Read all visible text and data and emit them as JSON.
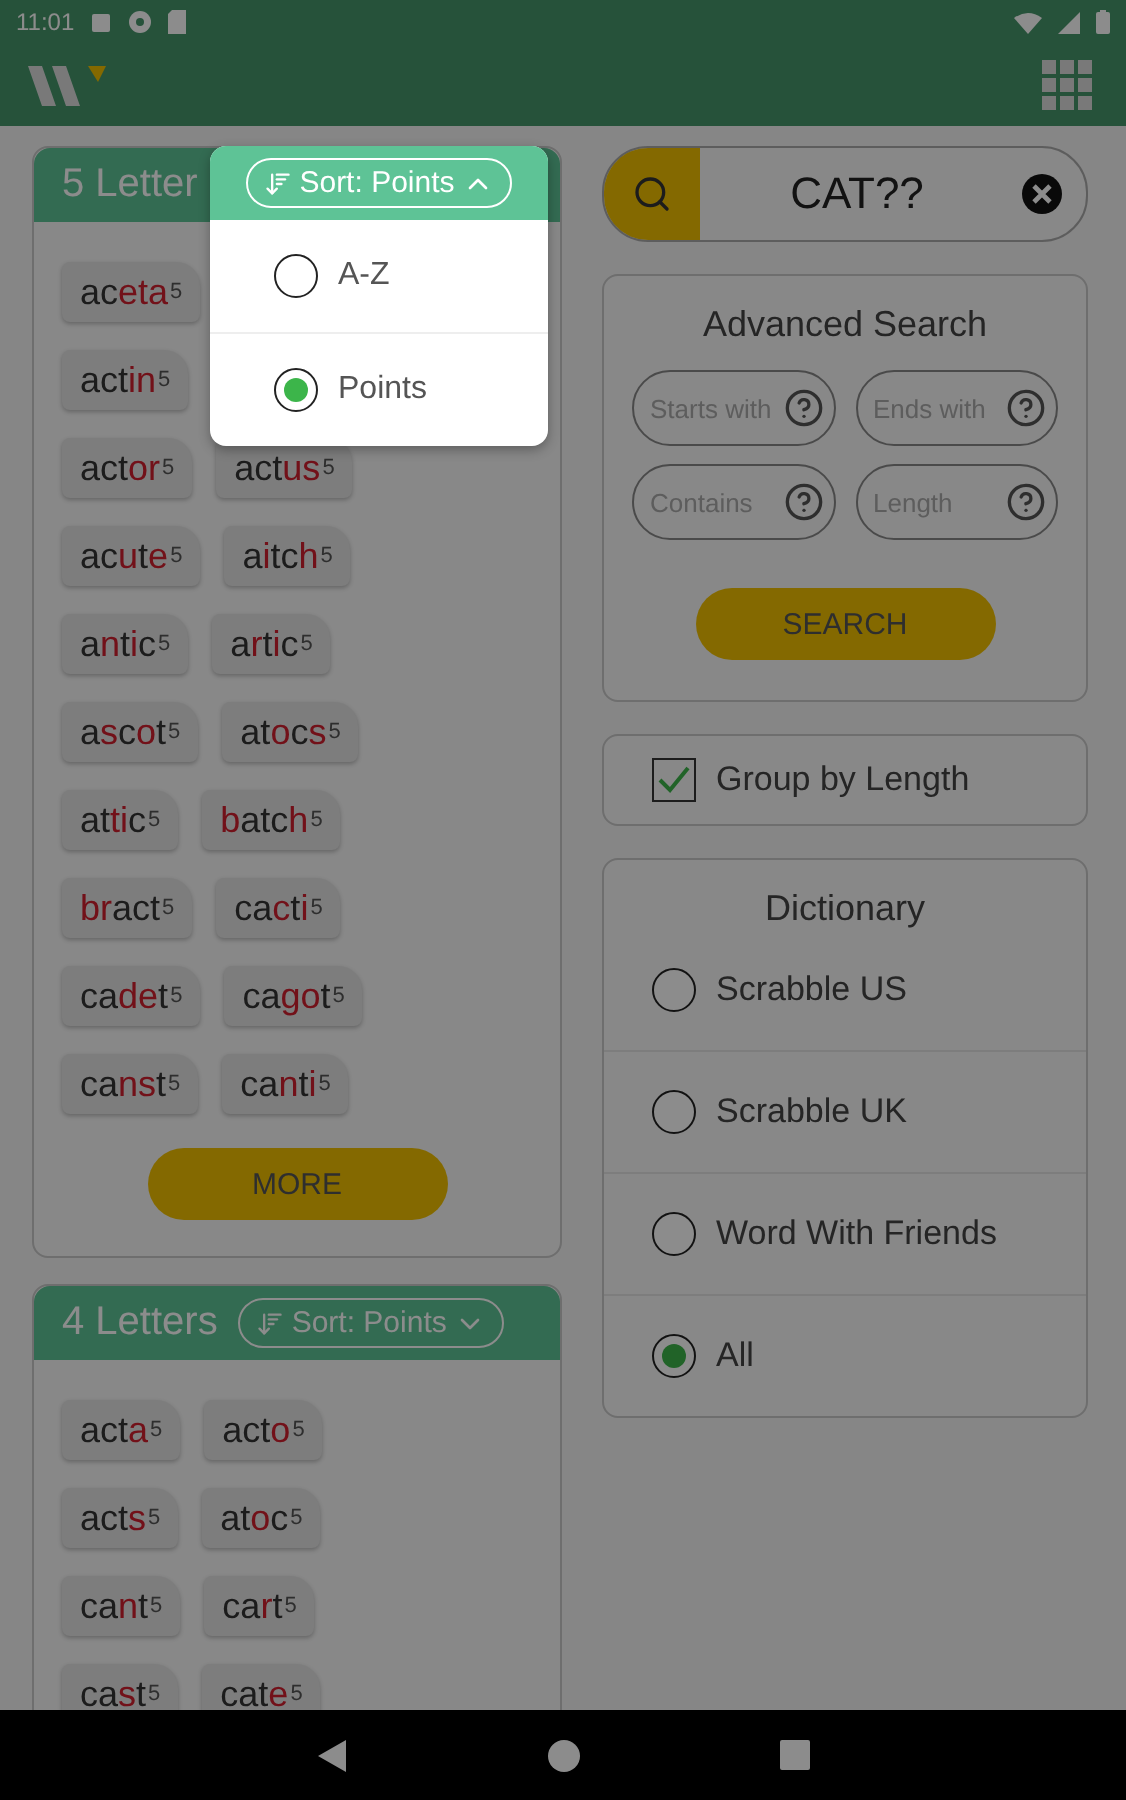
{
  "status_bar": {
    "time": "11:01"
  },
  "sections": [
    {
      "title": "5 Letter",
      "rows": [
        [
          {
            "parts": [
              {
                "text": "ac",
                "wild": false
              },
              {
                "text": "eta",
                "wild": true
              }
            ],
            "points": "5"
          }
        ],
        [
          {
            "parts": [
              {
                "text": "act",
                "wild": false
              },
              {
                "text": "in",
                "wild": true
              }
            ],
            "points": "5"
          }
        ],
        [
          {
            "parts": [
              {
                "text": "act",
                "wild": false
              },
              {
                "text": "or",
                "wild": true
              }
            ],
            "points": "5"
          },
          {
            "parts": [
              {
                "text": "act",
                "wild": false
              },
              {
                "text": "us",
                "wild": true
              }
            ],
            "points": "5"
          }
        ],
        [
          {
            "parts": [
              {
                "text": "ac",
                "wild": false
              },
              {
                "text": "u",
                "wild": true
              },
              {
                "text": "t",
                "wild": false
              },
              {
                "text": "e",
                "wild": true
              }
            ],
            "points": "5"
          },
          {
            "parts": [
              {
                "text": "a",
                "wild": false
              },
              {
                "text": "i",
                "wild": true
              },
              {
                "text": "tc",
                "wild": false
              },
              {
                "text": "h",
                "wild": true
              }
            ],
            "points": "5"
          }
        ],
        [
          {
            "parts": [
              {
                "text": "a",
                "wild": false
              },
              {
                "text": "n",
                "wild": true
              },
              {
                "text": "t",
                "wild": false
              },
              {
                "text": "i",
                "wild": true
              },
              {
                "text": "c",
                "wild": false
              }
            ],
            "points": "5"
          },
          {
            "parts": [
              {
                "text": "a",
                "wild": false
              },
              {
                "text": "r",
                "wild": true
              },
              {
                "text": "t",
                "wild": false
              },
              {
                "text": "i",
                "wild": true
              },
              {
                "text": "c",
                "wild": false
              }
            ],
            "points": "5"
          }
        ],
        [
          {
            "parts": [
              {
                "text": "a",
                "wild": false
              },
              {
                "text": "s",
                "wild": true
              },
              {
                "text": "c",
                "wild": false
              },
              {
                "text": "o",
                "wild": true
              },
              {
                "text": "t",
                "wild": false
              }
            ],
            "points": "5"
          },
          {
            "parts": [
              {
                "text": "at",
                "wild": false
              },
              {
                "text": "o",
                "wild": true
              },
              {
                "text": "c",
                "wild": false
              },
              {
                "text": "s",
                "wild": true
              }
            ],
            "points": "5"
          }
        ],
        [
          {
            "parts": [
              {
                "text": "at",
                "wild": false
              },
              {
                "text": "ti",
                "wild": true
              },
              {
                "text": "c",
                "wild": false
              }
            ],
            "points": "5"
          },
          {
            "parts": [
              {
                "text": "b",
                "wild": true
              },
              {
                "text": "atc",
                "wild": false
              },
              {
                "text": "h",
                "wild": true
              }
            ],
            "points": "5"
          }
        ],
        [
          {
            "parts": [
              {
                "text": "br",
                "wild": true
              },
              {
                "text": "act",
                "wild": false
              }
            ],
            "points": "5"
          },
          {
            "parts": [
              {
                "text": "ca",
                "wild": false
              },
              {
                "text": "c",
                "wild": true
              },
              {
                "text": "t",
                "wild": false
              },
              {
                "text": "i",
                "wild": true
              }
            ],
            "points": "5"
          }
        ],
        [
          {
            "parts": [
              {
                "text": "ca",
                "wild": false
              },
              {
                "text": "de",
                "wild": true
              },
              {
                "text": "t",
                "wild": false
              }
            ],
            "points": "5"
          },
          {
            "parts": [
              {
                "text": "ca",
                "wild": false
              },
              {
                "text": "go",
                "wild": true
              },
              {
                "text": "t",
                "wild": false
              }
            ],
            "points": "5"
          }
        ],
        [
          {
            "parts": [
              {
                "text": "ca",
                "wild": false
              },
              {
                "text": "ns",
                "wild": true
              },
              {
                "text": "t",
                "wild": false
              }
            ],
            "points": "5"
          },
          {
            "parts": [
              {
                "text": "ca",
                "wild": false
              },
              {
                "text": "n",
                "wild": true
              },
              {
                "text": "t",
                "wild": false
              },
              {
                "text": "i",
                "wild": true
              }
            ],
            "points": "5"
          }
        ]
      ],
      "more_button": "MORE"
    },
    {
      "title": "4 Letters",
      "sort": {
        "label": "Sort: Points",
        "expanded": false
      },
      "rows": [
        [
          {
            "parts": [
              {
                "text": "act",
                "wild": false
              },
              {
                "text": "a",
                "wild": true
              }
            ],
            "points": "5"
          },
          {
            "parts": [
              {
                "text": "act",
                "wild": false
              },
              {
                "text": "o",
                "wild": true
              }
            ],
            "points": "5"
          }
        ],
        [
          {
            "parts": [
              {
                "text": "act",
                "wild": false
              },
              {
                "text": "s",
                "wild": true
              }
            ],
            "points": "5"
          },
          {
            "parts": [
              {
                "text": "at",
                "wild": false
              },
              {
                "text": "o",
                "wild": true
              },
              {
                "text": "c",
                "wild": false
              }
            ],
            "points": "5"
          }
        ],
        [
          {
            "parts": [
              {
                "text": "ca",
                "wild": false
              },
              {
                "text": "n",
                "wild": true
              },
              {
                "text": "t",
                "wild": false
              }
            ],
            "points": "5"
          },
          {
            "parts": [
              {
                "text": "ca",
                "wild": false
              },
              {
                "text": "r",
                "wild": true
              },
              {
                "text": "t",
                "wild": false
              }
            ],
            "points": "5"
          }
        ],
        [
          {
            "parts": [
              {
                "text": "ca",
                "wild": false
              },
              {
                "text": "s",
                "wild": true
              },
              {
                "text": "t",
                "wild": false
              }
            ],
            "points": "5"
          },
          {
            "parts": [
              {
                "text": "cat",
                "wild": false
              },
              {
                "text": "e",
                "wild": true
              }
            ],
            "points": "5"
          }
        ]
      ]
    }
  ],
  "sort_menu": {
    "label": "Sort: Points",
    "expanded": true,
    "options": [
      {
        "label": "A-Z",
        "selected": false
      },
      {
        "label": "Points",
        "selected": true
      }
    ]
  },
  "search": {
    "value": "CAT??"
  },
  "advanced_search": {
    "title": "Advanced Search",
    "fields": [
      {
        "placeholder": "Starts with"
      },
      {
        "placeholder": "Ends with"
      },
      {
        "placeholder": "Contains"
      },
      {
        "placeholder": "Length"
      }
    ],
    "button": "SEARCH"
  },
  "group_by_length": {
    "label": "Group by Length",
    "checked": true
  },
  "dictionary": {
    "title": "Dictionary",
    "options": [
      {
        "label": "Scrabble US",
        "selected": false
      },
      {
        "label": "Scrabble UK",
        "selected": false
      },
      {
        "label": "Word With Friends",
        "selected": false
      },
      {
        "label": "All",
        "selected": true
      }
    ]
  }
}
